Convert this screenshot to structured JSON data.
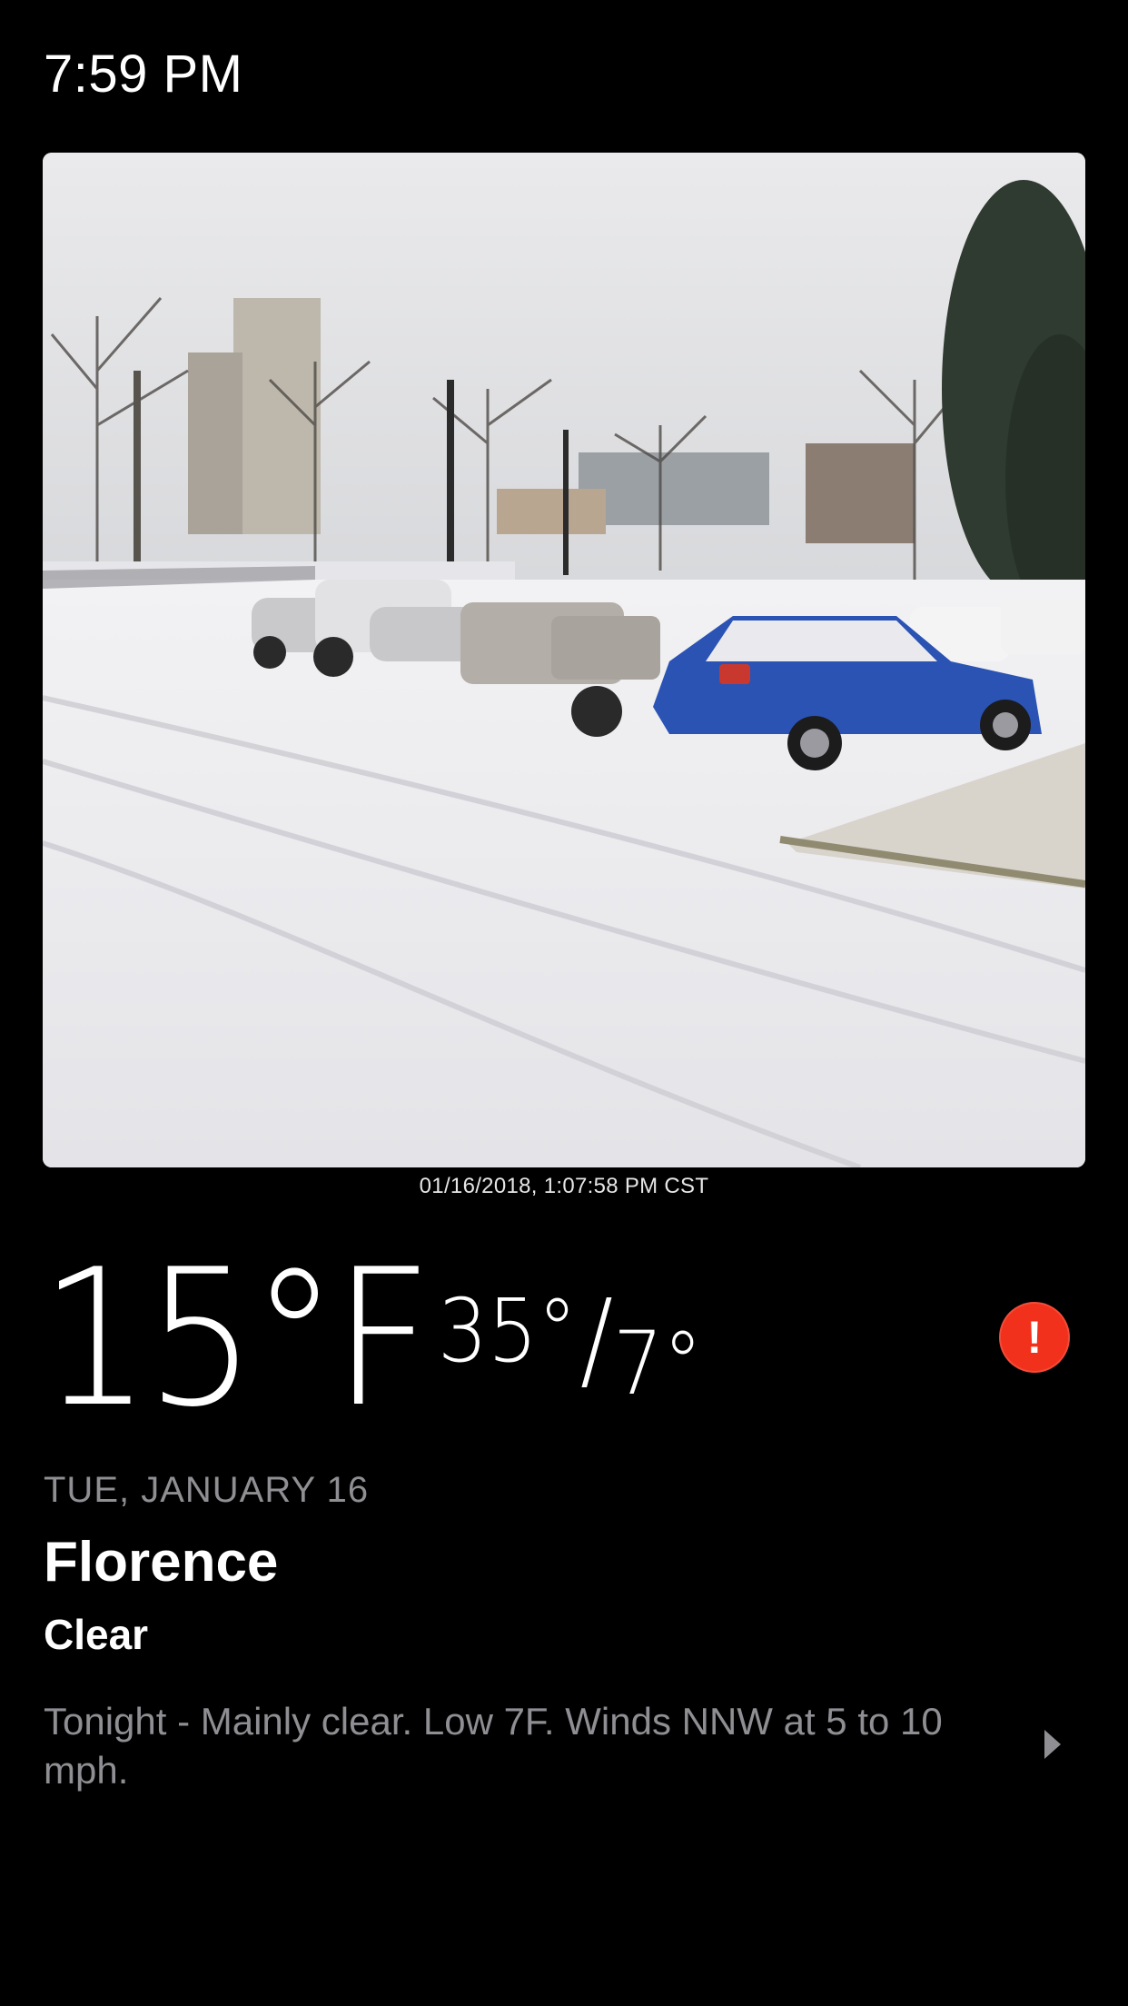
{
  "status_bar": {
    "time": "7:59 PM"
  },
  "photo": {
    "timestamp": "01/16/2018, 1:07:58 PM CST"
  },
  "weather": {
    "current_temp": "15°F",
    "high": "35°",
    "slash": "/",
    "low": "7°",
    "alert_symbol": "!",
    "date": "TUE, JANUARY 16",
    "city": "Florence",
    "condition": "Clear",
    "forecast": "Tonight - Mainly clear. Low 7F. Winds NNW at 5 to 10 mph."
  },
  "colors": {
    "alert": "#f1311b",
    "secondary_text": "#8e8e93",
    "background": "#000000"
  }
}
